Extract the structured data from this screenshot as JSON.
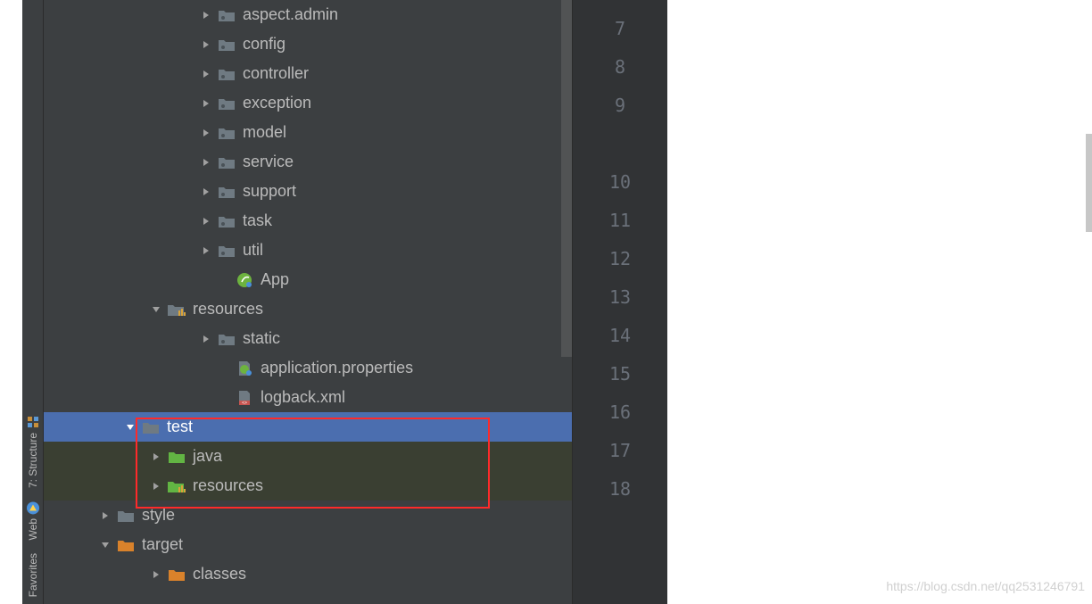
{
  "sidebar": {
    "tabs": [
      {
        "label": "7: Structure"
      },
      {
        "label": "Web"
      },
      {
        "label": "Favorites"
      }
    ]
  },
  "tree": {
    "items": [
      {
        "label": "aspect.admin",
        "indent": 175,
        "arrow": "right",
        "icon": "package",
        "selected": false,
        "test": false
      },
      {
        "label": "config",
        "indent": 175,
        "arrow": "right",
        "icon": "package",
        "selected": false,
        "test": false
      },
      {
        "label": "controller",
        "indent": 175,
        "arrow": "right",
        "icon": "package",
        "selected": false,
        "test": false
      },
      {
        "label": "exception",
        "indent": 175,
        "arrow": "right",
        "icon": "package",
        "selected": false,
        "test": false
      },
      {
        "label": "model",
        "indent": 175,
        "arrow": "right",
        "icon": "package",
        "selected": false,
        "test": false
      },
      {
        "label": "service",
        "indent": 175,
        "arrow": "right",
        "icon": "package",
        "selected": false,
        "test": false
      },
      {
        "label": "support",
        "indent": 175,
        "arrow": "right",
        "icon": "package",
        "selected": false,
        "test": false
      },
      {
        "label": "task",
        "indent": 175,
        "arrow": "right",
        "icon": "package",
        "selected": false,
        "test": false
      },
      {
        "label": "util",
        "indent": 175,
        "arrow": "right",
        "icon": "package",
        "selected": false,
        "test": false
      },
      {
        "label": "App",
        "indent": 195,
        "arrow": "none",
        "icon": "spring",
        "selected": false,
        "test": false
      },
      {
        "label": "resources",
        "indent": 119,
        "arrow": "down",
        "icon": "resources",
        "selected": false,
        "test": false
      },
      {
        "label": "static",
        "indent": 175,
        "arrow": "right",
        "icon": "package",
        "selected": false,
        "test": false
      },
      {
        "label": "application.properties",
        "indent": 195,
        "arrow": "none",
        "icon": "spring-file",
        "selected": false,
        "test": false
      },
      {
        "label": "logback.xml",
        "indent": 195,
        "arrow": "none",
        "icon": "xml",
        "selected": false,
        "test": false
      },
      {
        "label": "test",
        "indent": 90,
        "arrow": "down",
        "icon": "folder",
        "selected": true,
        "test": false
      },
      {
        "label": "java",
        "indent": 119,
        "arrow": "right",
        "icon": "green-folder",
        "selected": false,
        "test": true
      },
      {
        "label": "resources",
        "indent": 119,
        "arrow": "right",
        "icon": "test-resources",
        "selected": false,
        "test": true
      },
      {
        "label": "style",
        "indent": 62,
        "arrow": "right",
        "icon": "folder",
        "selected": false,
        "test": false
      },
      {
        "label": "target",
        "indent": 62,
        "arrow": "down",
        "icon": "orange-folder",
        "selected": false,
        "test": false
      },
      {
        "label": "classes",
        "indent": 119,
        "arrow": "right",
        "icon": "orange-folder",
        "selected": false,
        "test": false
      }
    ]
  },
  "gutter": {
    "lines": [
      "7",
      "8",
      "9",
      "",
      "10",
      "11",
      "12",
      "13",
      "14",
      "15",
      "16",
      "17",
      "18"
    ]
  },
  "watermark": "https://blog.csdn.net/qq2531246791"
}
